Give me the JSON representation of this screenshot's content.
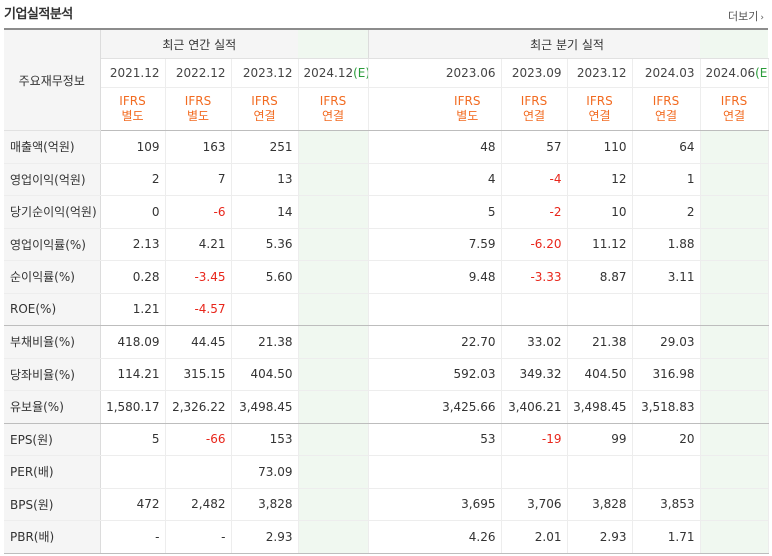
{
  "section": {
    "title": "기업실적분석",
    "more_label": "더보기"
  },
  "header": {
    "row_header": "주요재무정보",
    "annual_group": "최근 연간 실적",
    "quarter_group": "최근 분기 실적",
    "annual_periods": [
      {
        "date": "2021.12",
        "est": "",
        "type1": "IFRS",
        "type2": "별도"
      },
      {
        "date": "2022.12",
        "est": "",
        "type1": "IFRS",
        "type2": "별도"
      },
      {
        "date": "2023.12",
        "est": "",
        "type1": "IFRS",
        "type2": "연결"
      },
      {
        "date": "2024.12",
        "est": "(E)",
        "type1": "IFRS",
        "type2": "연결"
      }
    ],
    "quarter_periods": [
      {
        "date": "2023.06",
        "est": "",
        "type1": "IFRS",
        "type2": "별도"
      },
      {
        "date": "2023.09",
        "est": "",
        "type1": "IFRS",
        "type2": "연결"
      },
      {
        "date": "2023.12",
        "est": "",
        "type1": "IFRS",
        "type2": "연결"
      },
      {
        "date": "2024.03",
        "est": "",
        "type1": "IFRS",
        "type2": "연결"
      },
      {
        "date": "2024.06",
        "est": "(E)",
        "type1": "IFRS",
        "type2": "연결"
      }
    ]
  },
  "rows": [
    {
      "label": "매출액(억원)",
      "annual": [
        "109",
        "163",
        "251",
        ""
      ],
      "quarter": [
        "48",
        "57",
        "110",
        "64",
        ""
      ]
    },
    {
      "label": "영업이익(억원)",
      "annual": [
        "2",
        "7",
        "13",
        ""
      ],
      "quarter": [
        "4",
        "-4",
        "12",
        "1",
        ""
      ]
    },
    {
      "label": "당기순이익(억원)",
      "annual": [
        "0",
        "-6",
        "14",
        ""
      ],
      "quarter": [
        "5",
        "-2",
        "10",
        "2",
        ""
      ]
    },
    {
      "label": "영업이익률(%)",
      "annual": [
        "2.13",
        "4.21",
        "5.36",
        ""
      ],
      "quarter": [
        "7.59",
        "-6.20",
        "11.12",
        "1.88",
        ""
      ]
    },
    {
      "label": "순이익률(%)",
      "annual": [
        "0.28",
        "-3.45",
        "5.60",
        ""
      ],
      "quarter": [
        "9.48",
        "-3.33",
        "8.87",
        "3.11",
        ""
      ]
    },
    {
      "label": "ROE(%)",
      "annual": [
        "1.21",
        "-4.57",
        "",
        ""
      ],
      "quarter": [
        "",
        "",
        "",
        "",
        ""
      ]
    },
    {
      "label": "부채비율(%)",
      "annual": [
        "418.09",
        "44.45",
        "21.38",
        ""
      ],
      "quarter": [
        "22.70",
        "33.02",
        "21.38",
        "29.03",
        ""
      ]
    },
    {
      "label": "당좌비율(%)",
      "annual": [
        "114.21",
        "315.15",
        "404.50",
        ""
      ],
      "quarter": [
        "592.03",
        "349.32",
        "404.50",
        "316.98",
        ""
      ]
    },
    {
      "label": "유보율(%)",
      "annual": [
        "1,580.17",
        "2,326.22",
        "3,498.45",
        ""
      ],
      "quarter": [
        "3,425.66",
        "3,406.21",
        "3,498.45",
        "3,518.83",
        ""
      ]
    },
    {
      "label": "EPS(원)",
      "annual": [
        "5",
        "-66",
        "153",
        ""
      ],
      "quarter": [
        "53",
        "-19",
        "99",
        "20",
        ""
      ]
    },
    {
      "label": "PER(배)",
      "annual": [
        "",
        "",
        "73.09",
        ""
      ],
      "quarter": [
        "",
        "",
        "",
        "",
        ""
      ]
    },
    {
      "label": "BPS(원)",
      "annual": [
        "472",
        "2,482",
        "3,828",
        ""
      ],
      "quarter": [
        "3,695",
        "3,706",
        "3,828",
        "3,853",
        ""
      ]
    },
    {
      "label": "PBR(배)",
      "annual": [
        "-",
        "-",
        "2.93",
        ""
      ],
      "quarter": [
        "4.26",
        "2.01",
        "2.93",
        "1.71",
        ""
      ]
    }
  ],
  "colors": {
    "accent_orange": "#f26b21",
    "negative_red": "#e8261b",
    "estimate_green": "#2a9c3a",
    "estimate_bg": "#f0f8f0"
  }
}
